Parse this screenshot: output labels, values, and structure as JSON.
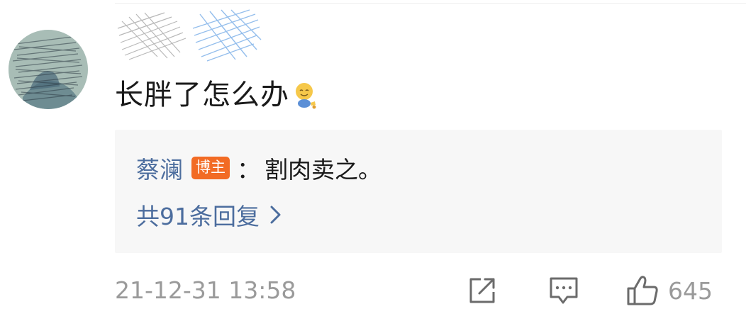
{
  "comment": {
    "username": "",
    "text": "长胖了怎么办",
    "emoji": "sweat-smile-emoji"
  },
  "reply": {
    "author": "蔡澜",
    "badge": "博主",
    "colon": "：",
    "content": "割肉卖之。",
    "more_label": "共91条回复"
  },
  "footer": {
    "timestamp": "21-12-31 13:58",
    "like_count": "645",
    "icons": [
      "share-icon",
      "comment-icon",
      "like-icon"
    ]
  },
  "colors": {
    "link": "#4c6d9e",
    "badge": "#f26b24",
    "muted": "#9a9a9a",
    "reply_bg": "#f7f7f7"
  }
}
